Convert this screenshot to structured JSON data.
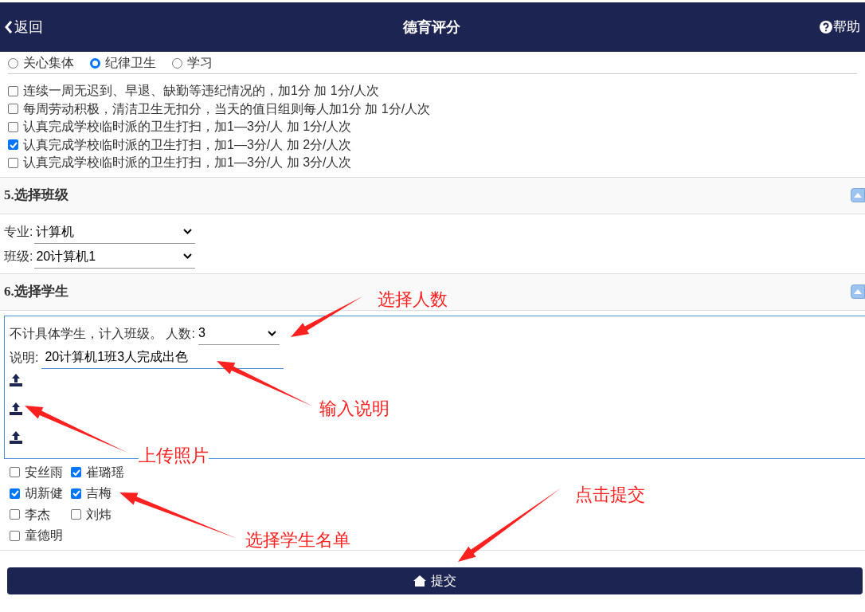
{
  "header": {
    "back": "返回",
    "title": "德育评分",
    "help": "帮助"
  },
  "categories": [
    {
      "label": "关心集体",
      "selected": false
    },
    {
      "label": "纪律卫生",
      "selected": true
    },
    {
      "label": "学习",
      "selected": false
    }
  ],
  "items": [
    {
      "label": "连续一周无迟到、早退、缺勤等违纪情况的，加1分 加 1分/人次",
      "checked": false
    },
    {
      "label": "每周劳动积极，清洁卫生无扣分，当天的值日组则每人加1分 加 1分/人次",
      "checked": false
    },
    {
      "label": "认真完成学校临时派的卫生打扫，加1—3分/人 加 1分/人次",
      "checked": false
    },
    {
      "label": "认真完成学校临时派的卫生打扫，加1—3分/人 加 2分/人次",
      "checked": true
    },
    {
      "label": "认真完成学校临时派的卫生打扫，加1—3分/人 加 3分/人次",
      "checked": false
    }
  ],
  "class_section": {
    "title": "5.选择班级",
    "fields": [
      {
        "label": "专业:",
        "value": "计算机"
      },
      {
        "label": "班级:",
        "value": "20计算机1"
      }
    ]
  },
  "student_section": {
    "title": "6.选择学生",
    "count_label": "不计具体学生，计入班级。 人数:",
    "count_value": "3",
    "note_label": "说明:",
    "note_value": "20计算机1班3人完成出色",
    "uploads": [
      {
        "kind": "upload"
      },
      {
        "kind": "upload"
      },
      {
        "kind": "upload"
      }
    ]
  },
  "students": [
    {
      "name": "安丝雨",
      "checked": false
    },
    {
      "name": "崔璐瑶",
      "checked": true
    },
    {
      "name": "胡新健",
      "checked": true
    },
    {
      "name": "吉梅",
      "checked": true
    },
    {
      "name": "李杰",
      "checked": false
    },
    {
      "name": "刘炜",
      "checked": false
    },
    {
      "name": "童德明",
      "checked": false
    }
  ],
  "submit": "提交",
  "annotations": [
    "选择人数",
    "输入说明",
    "上传照片",
    "选择学生名单",
    "点击提交"
  ]
}
